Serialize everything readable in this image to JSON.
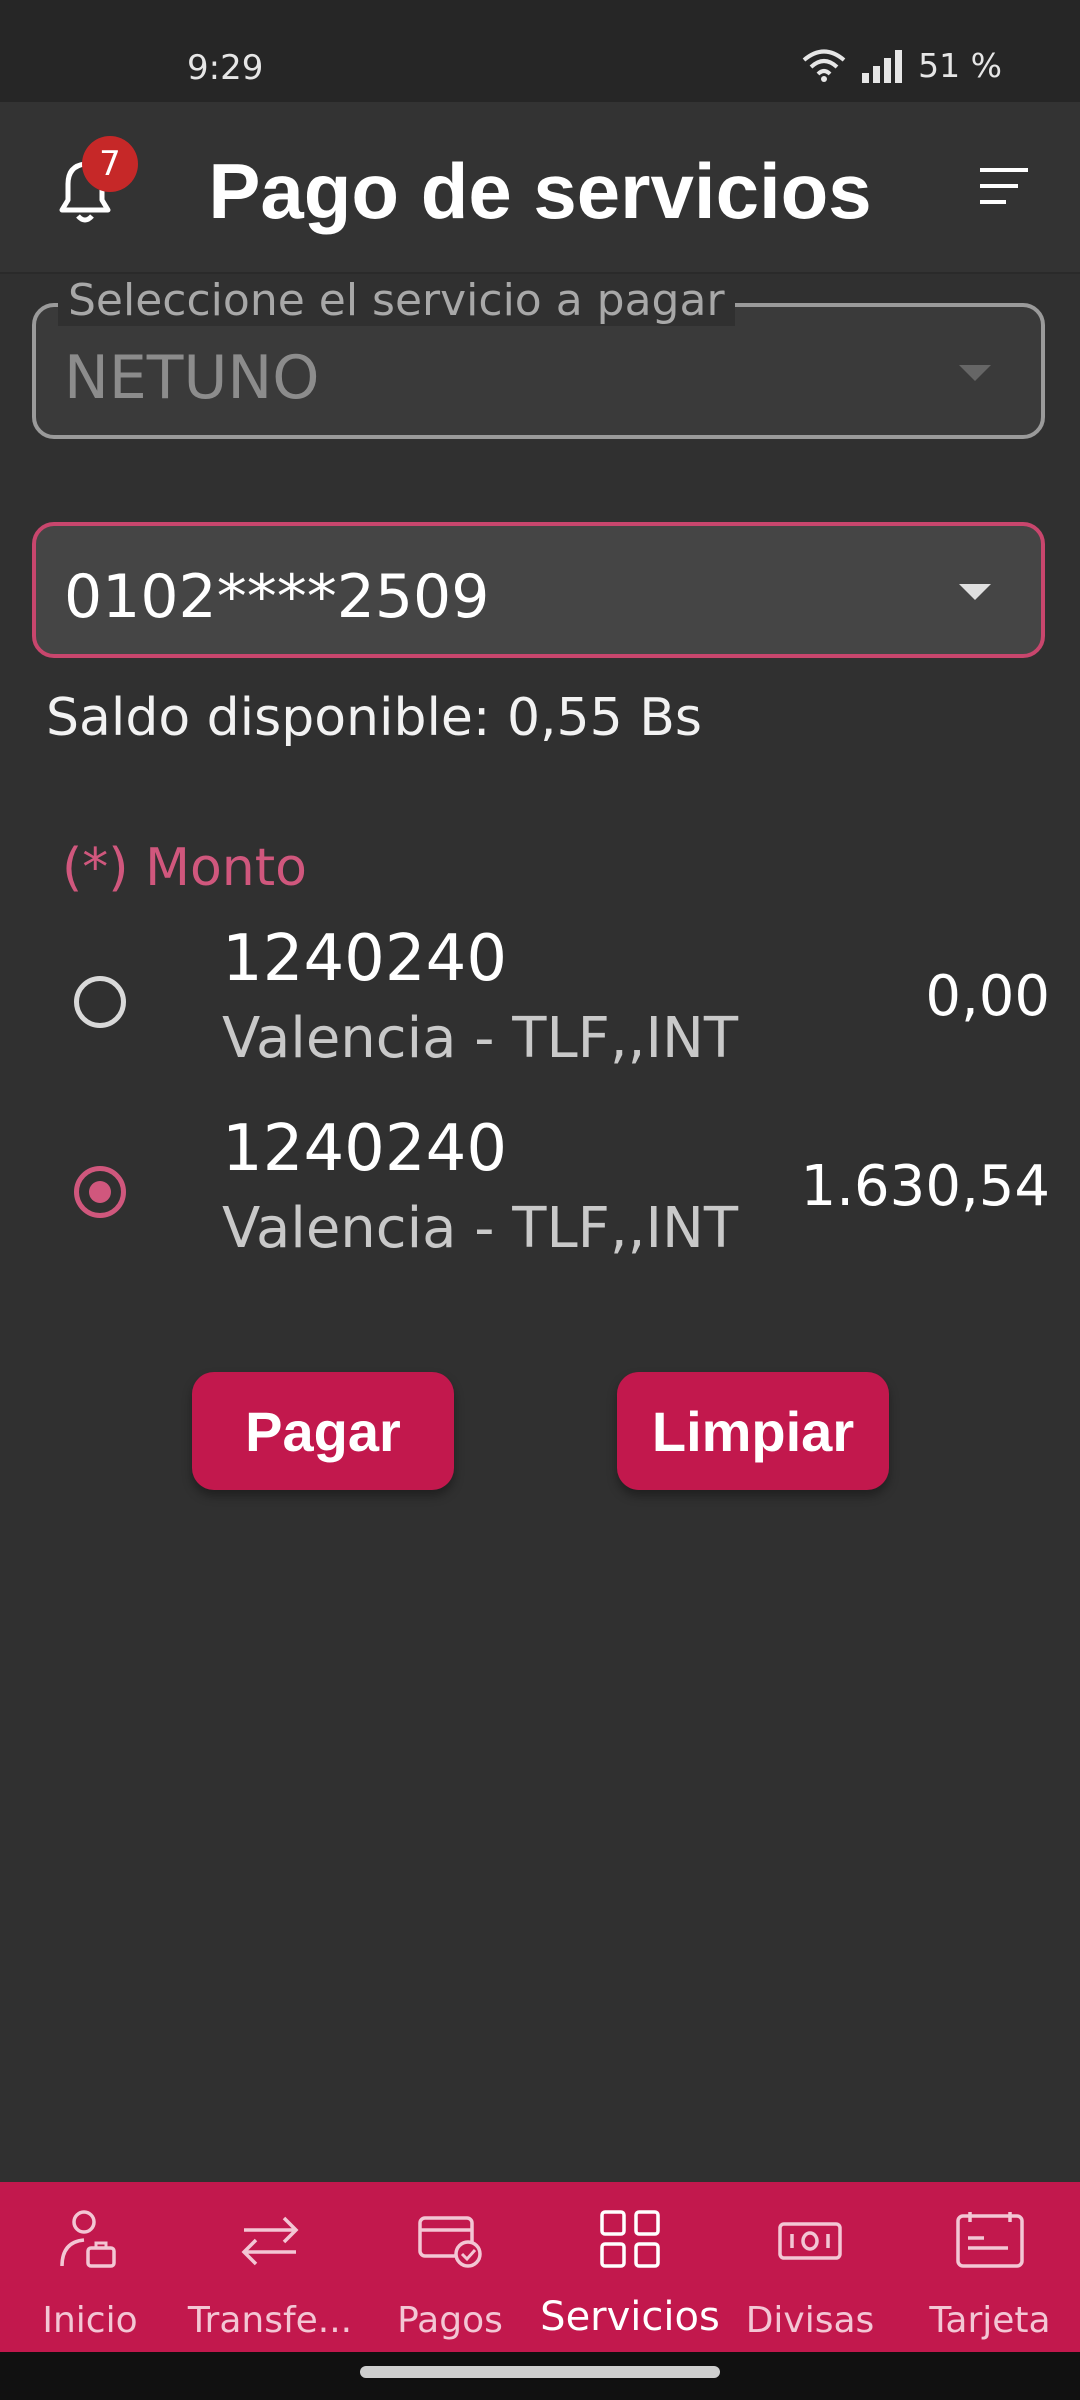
{
  "status_bar": {
    "time": "9:29",
    "battery": "51 %"
  },
  "header": {
    "title": "Pago de servicios",
    "notification_count": "7"
  },
  "service_select": {
    "legend": "Seleccione el servicio a pagar",
    "value": "NETUNO"
  },
  "account_select": {
    "value": "0102****2509"
  },
  "balance_text": "Saldo disponible: 0,55 Bs",
  "amount_label": "(*) Monto",
  "options": [
    {
      "code": "1240240",
      "description": "Valencia - TLF,,INT",
      "amount": "0,00",
      "selected": false
    },
    {
      "code": "1240240",
      "description": "Valencia - TLF,,INT",
      "amount": "1.630,54",
      "selected": true
    }
  ],
  "buttons": {
    "pay": "Pagar",
    "clear": "Limpiar"
  },
  "nav": [
    {
      "label": "Inicio",
      "icon": "user-briefcase-icon"
    },
    {
      "label": "Transfe...",
      "icon": "transfer-arrows-icon"
    },
    {
      "label": "Pagos",
      "icon": "card-check-icon"
    },
    {
      "label": "Servicios",
      "icon": "grid-icon",
      "active": true
    },
    {
      "label": "Divisas",
      "icon": "banknote-icon"
    },
    {
      "label": "Tarjeta",
      "icon": "card-icon"
    }
  ],
  "colors": {
    "accent": "#c2184d",
    "accent_light": "#d0577d",
    "background": "#303030"
  }
}
